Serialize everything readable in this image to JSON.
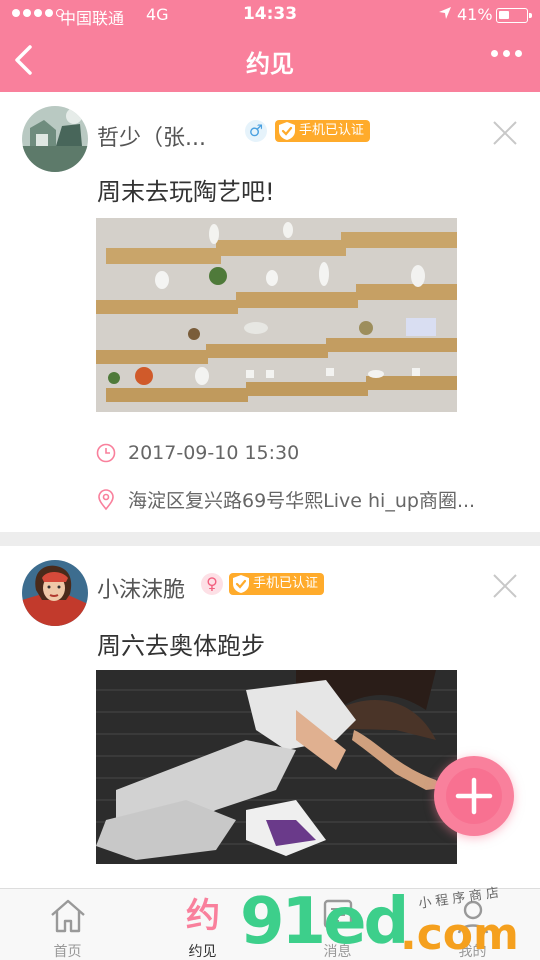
{
  "status_bar": {
    "carrier": "中国联通",
    "network": "4G",
    "time": "14:33",
    "battery": "41%",
    "battery_level": 0.41
  },
  "nav": {
    "title": "约见"
  },
  "posts": [
    {
      "username": "哲少（张...",
      "gender": "male",
      "gender_symbol": "♂",
      "badge": "手机已认证",
      "title": "周末去玩陶艺吧!",
      "time": "2017-09-10 15:30",
      "location": "海淀区复兴路69号华熙Live hi_up商圈..."
    },
    {
      "username": "小沫沫脆",
      "gender": "female",
      "gender_symbol": "♀",
      "badge": "手机已认证",
      "title": "周六去奥体跑步"
    }
  ],
  "tabbar": {
    "items": [
      {
        "label": "首页",
        "icon": "home-icon"
      },
      {
        "label": "约见",
        "icon": "yue-icon",
        "glyph": "约",
        "active": true
      },
      {
        "label": "消息",
        "icon": "message-icon"
      },
      {
        "label": "我的",
        "icon": "profile-icon"
      }
    ]
  },
  "watermark": {
    "number": "91ed",
    "suffix": ".com",
    "shop": "小程序商店"
  },
  "colors": {
    "brand_pink": "#f9809c",
    "badge_orange": "#ffab2b",
    "male_blue": "#4aa0e0",
    "female_pink": "#f2607f"
  }
}
